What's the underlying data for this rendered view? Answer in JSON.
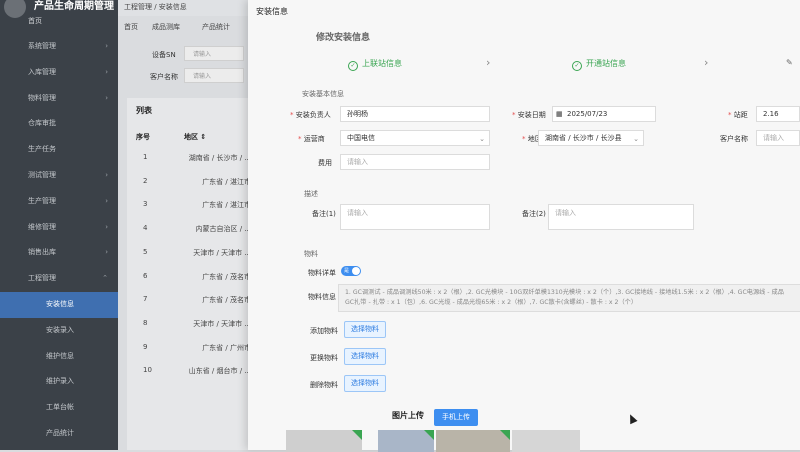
{
  "app": {
    "title": "产品生命周期管理",
    "home": "首页"
  },
  "sidebar": {
    "items": [
      {
        "label": "系统管理",
        "chev": "›"
      },
      {
        "label": "入库管理",
        "chev": "›"
      },
      {
        "label": "物料管理",
        "chev": "›"
      },
      {
        "label": "仓库审批",
        "chev": ""
      },
      {
        "label": "生产任务",
        "chev": ""
      },
      {
        "label": "测试管理",
        "chev": "›"
      },
      {
        "label": "生产管理",
        "chev": "›"
      },
      {
        "label": "维修管理",
        "chev": "›"
      },
      {
        "label": "销售出库",
        "chev": "›"
      },
      {
        "label": "工程管理",
        "chev": "⌃"
      }
    ],
    "subitems": [
      "安装信息",
      "安装录入",
      "维护信息",
      "维护录入",
      "工单台帐",
      "产品统计"
    ]
  },
  "breadcrumb": "工程管理 / 安装信息",
  "bg_tabs": [
    "首页",
    "成品测库",
    "产品统计"
  ],
  "filters": {
    "sn_label": "设备SN",
    "sn_placeholder": "请输入",
    "customer_label": "客户名称",
    "customer_placeholder": "请输入"
  },
  "list": {
    "title": "列表",
    "headers": [
      "序号",
      "地区 ⇕"
    ],
    "rows": [
      {
        "no": "1",
        "area": "湖南省 / 长沙市 / ..."
      },
      {
        "no": "2",
        "area": "广东省 / 湛江市"
      },
      {
        "no": "3",
        "area": "广东省 / 湛江市"
      },
      {
        "no": "4",
        "area": "内蒙古自治区 / ..."
      },
      {
        "no": "5",
        "area": "天津市 / 天津市 ..."
      },
      {
        "no": "6",
        "area": "广东省 / 茂名市"
      },
      {
        "no": "7",
        "area": "广东省 / 茂名市"
      },
      {
        "no": "8",
        "area": "天津市 / 天津市 ..."
      },
      {
        "no": "9",
        "area": "广东省 / 广州市"
      },
      {
        "no": "10",
        "area": "山东省 / 烟台市 / ..."
      }
    ]
  },
  "drawer": {
    "title": "安装信息",
    "cut_title": "修改安装信息",
    "steps": [
      {
        "label": "上联站信息",
        "color": "#3aa552"
      },
      {
        "label": "开通站信息",
        "color": "#3aa552"
      },
      {
        "label": "",
        "color": "#666666"
      }
    ],
    "basic_section": "安装基本信息",
    "fields": {
      "owner_label": "安装负责人",
      "owner_value": "孙明杨",
      "date_label": "安装日期",
      "date_value": "2025/07/23",
      "distance_label": "站距",
      "distance_value": "2.16",
      "operator_label": "运营商",
      "operator_value": "中国电信",
      "region_label": "地区",
      "region_value": "湖南省 / 长沙市 / 长沙县",
      "customer_label": "客户名称",
      "customer_placeholder": "请输入",
      "cost_label": "费用",
      "cost_placeholder": "请输入"
    },
    "desc_section": "描述",
    "remarks": {
      "r1_label": "备注(1)",
      "r1_placeholder": "请输入",
      "r2_label": "备注(2)",
      "r2_placeholder": "请输入"
    },
    "material_section": "物料",
    "material": {
      "detail_label": "物料详单",
      "toggle_text": "是",
      "info_label": "物料信息",
      "info_line1": "1. GC调测试 - 成品调测线50米 : x 2（根）,2. GC光模块 - 10G双纤单模1310光模块 : x 2（个）,3. GC接地线 - 接地线1.5米 : x 2（根）,4. GC电源线 - 成品",
      "info_line2": "GC扎带 - 扎带 : x 1（包）,6. GC光缆 - 成品光缆65米 : x 2（根）,7. GC散卡(含螺丝) - 散卡 : x 2（个）",
      "add_label": "添加物料",
      "replace_label": "更换物料",
      "delete_label": "删除物料",
      "select_btn": "选择物料"
    },
    "upload": {
      "title": "图片上传",
      "button": "手机上传"
    }
  }
}
